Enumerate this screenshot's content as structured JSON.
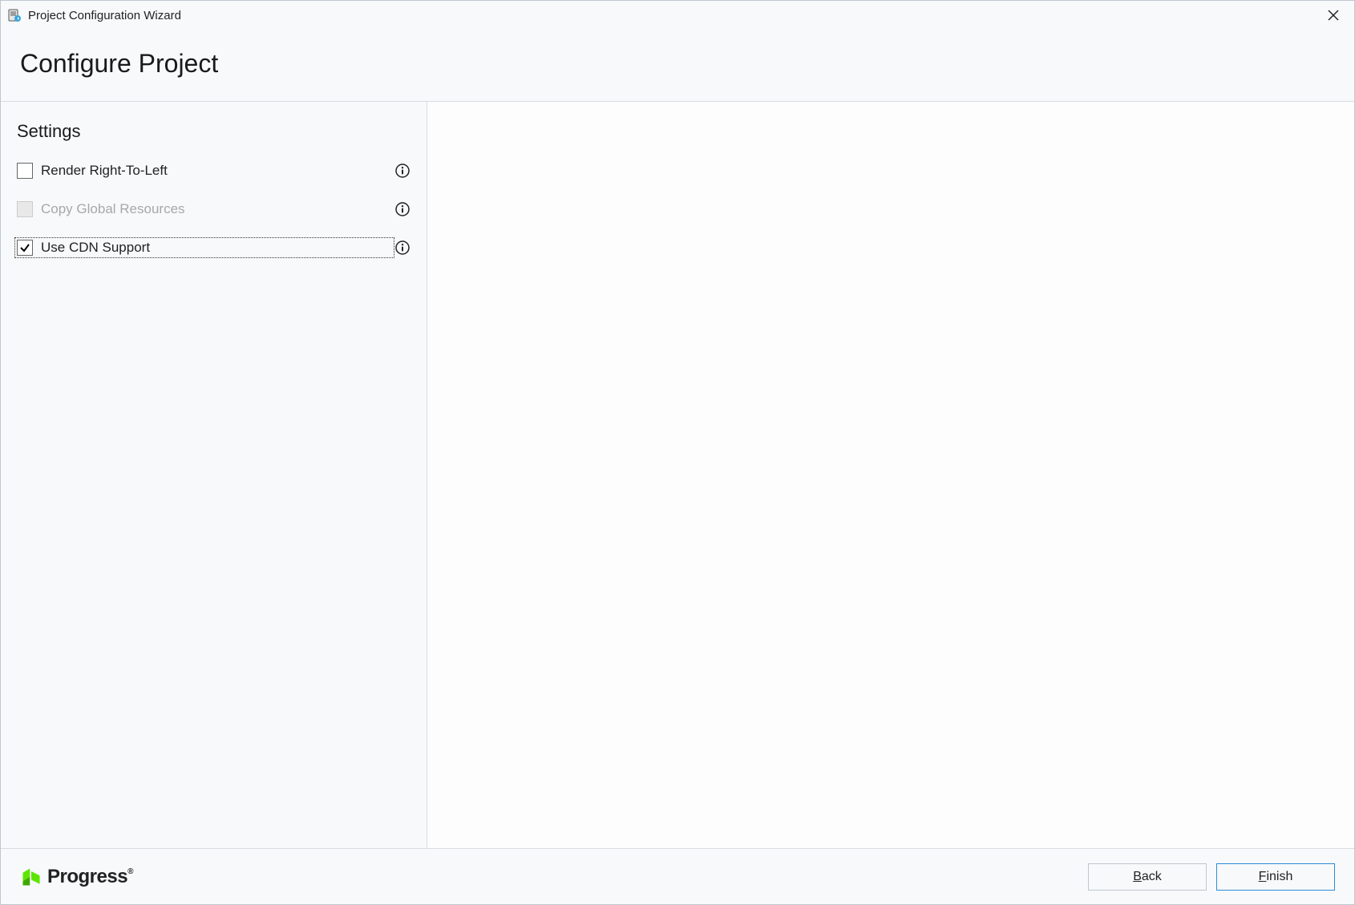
{
  "window": {
    "title": "Project Configuration Wizard"
  },
  "header": {
    "title": "Configure Project"
  },
  "settings": {
    "heading": "Settings",
    "items": [
      {
        "label": "Render Right-To-Left",
        "checked": false,
        "disabled": false,
        "focused": false
      },
      {
        "label": "Copy Global Resources",
        "checked": false,
        "disabled": true,
        "focused": false
      },
      {
        "label": "Use CDN Support",
        "checked": true,
        "disabled": false,
        "focused": true
      }
    ]
  },
  "footer": {
    "brand": "Progress",
    "back_label": "Back",
    "finish_label": "Finish"
  }
}
